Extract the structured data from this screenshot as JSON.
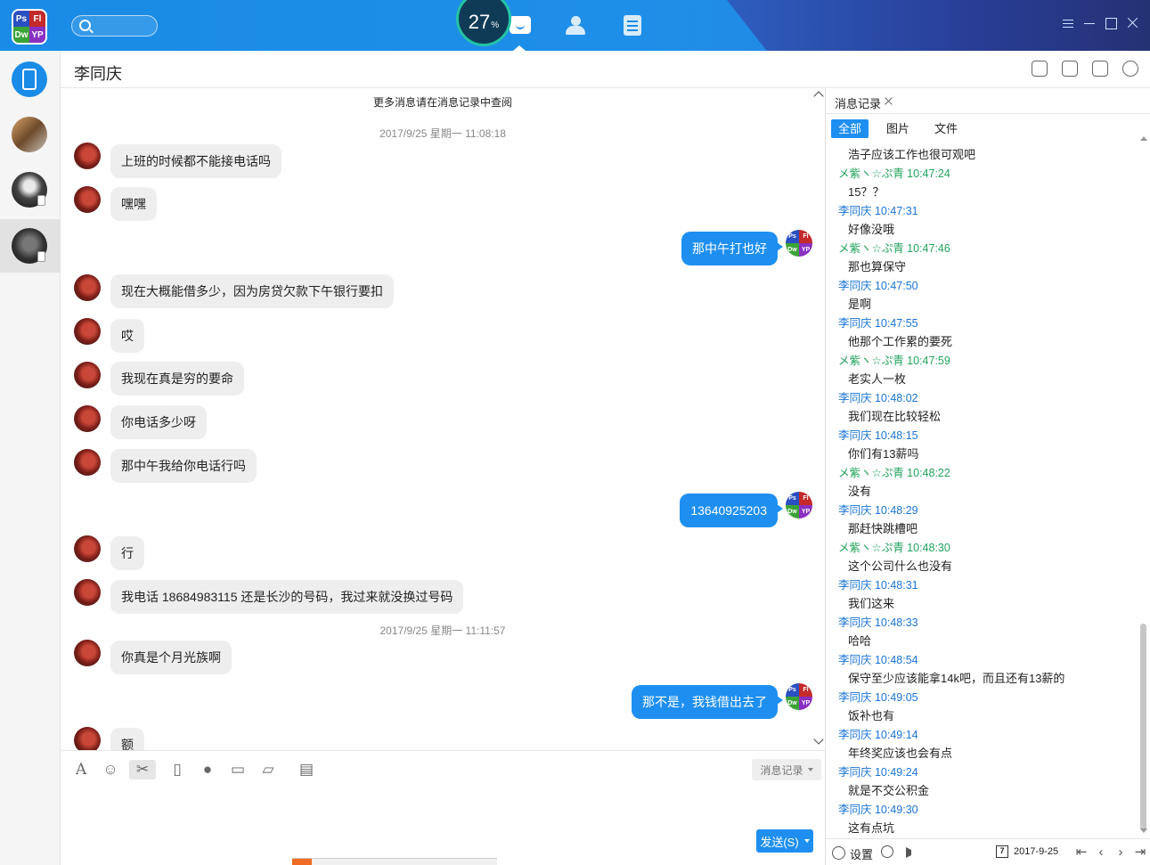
{
  "topbar": {
    "logo_letters": [
      "Ps",
      "Fl",
      "Dw",
      "YP"
    ],
    "logo_colors": [
      "#2a4fc2",
      "#c42a2a",
      "#3aa336",
      "#8a2fc2"
    ],
    "cpu_gauge": "27",
    "cpu_unit": "%"
  },
  "contacts": [
    {
      "name": "device",
      "icon": "phone-icon"
    },
    {
      "name": "contact-1",
      "icon": "avatar"
    },
    {
      "name": "contact-2",
      "icon": "avatar"
    },
    {
      "name": "contact-3",
      "icon": "avatar"
    }
  ],
  "chat": {
    "contact_name": "李同庆",
    "more_hint": "更多消息请在消息记录中查阅",
    "timestamps": [
      "2017/9/25 星期一 11:08:18",
      "2017/9/25 星期一 11:11:57"
    ],
    "messages_in": [
      "上班的时候都不能接电话吗",
      "嘿嘿",
      "现在大概能借多少，因为房贷欠款下午银行要扣",
      "哎",
      "我现在真是穷的要命",
      "你电话多少呀",
      "那中午我给你电话行吗",
      "行",
      "我电话 18684983115  还是长沙的号码，我过来就没换过号码",
      "你真是个月光族啊",
      "额"
    ],
    "messages_out": [
      "那中午打也好",
      "13640925203",
      "那不是，我钱借出去了"
    ]
  },
  "toolbar": {
    "history_label": "消息记录",
    "send_label": "发送(S)"
  },
  "history": {
    "tab_label": "消息记录",
    "filters": [
      "全部",
      "图片",
      "文件"
    ],
    "entries": [
      {
        "type": "text",
        "text": "浩子应该工作也很可观吧"
      },
      {
        "type": "me",
        "text": "メ紫ヽ☆ぷ青 10:47:24"
      },
      {
        "type": "text",
        "text": "15？？"
      },
      {
        "type": "them",
        "text": "李同庆 10:47:31"
      },
      {
        "type": "text",
        "text": "好像没哦"
      },
      {
        "type": "me",
        "text": "メ紫ヽ☆ぷ青 10:47:46"
      },
      {
        "type": "text",
        "text": "那也算保守"
      },
      {
        "type": "them",
        "text": "李同庆 10:47:50"
      },
      {
        "type": "text",
        "text": "是啊"
      },
      {
        "type": "them",
        "text": "李同庆 10:47:55"
      },
      {
        "type": "text",
        "text": "他那个工作累的要死"
      },
      {
        "type": "me",
        "text": "メ紫ヽ☆ぷ青 10:47:59"
      },
      {
        "type": "text",
        "text": "老实人一枚"
      },
      {
        "type": "them",
        "text": "李同庆 10:48:02"
      },
      {
        "type": "text",
        "text": "我们现在比较轻松"
      },
      {
        "type": "them",
        "text": "李同庆 10:48:15"
      },
      {
        "type": "text",
        "text": "你们有13薪吗"
      },
      {
        "type": "me",
        "text": "メ紫ヽ☆ぷ青 10:48:22"
      },
      {
        "type": "text",
        "text": "没有"
      },
      {
        "type": "them",
        "text": "李同庆 10:48:29"
      },
      {
        "type": "text",
        "text": "那赶快跳槽吧"
      },
      {
        "type": "me",
        "text": "メ紫ヽ☆ぷ青 10:48:30"
      },
      {
        "type": "text",
        "text": "这个公司什么也没有"
      },
      {
        "type": "them",
        "text": "李同庆 10:48:31"
      },
      {
        "type": "text",
        "text": "我们这来"
      },
      {
        "type": "them",
        "text": "李同庆 10:48:33"
      },
      {
        "type": "text",
        "text": "哈哈"
      },
      {
        "type": "them",
        "text": "李同庆 10:48:54"
      },
      {
        "type": "text",
        "text": "保守至少应该能拿14k吧，而且还有13薪的"
      },
      {
        "type": "them",
        "text": "李同庆 10:49:05"
      },
      {
        "type": "text",
        "text": "饭补也有"
      },
      {
        "type": "them",
        "text": "李同庆 10:49:14"
      },
      {
        "type": "text",
        "text": "年终奖应该也会有点"
      },
      {
        "type": "them",
        "text": "李同庆 10:49:24"
      },
      {
        "type": "text",
        "text": "就是不交公积金"
      },
      {
        "type": "them",
        "text": "李同庆 10:49:30"
      },
      {
        "type": "text",
        "text": "这有点坑"
      }
    ],
    "settings_label": "设置",
    "calendar_day": "7",
    "date": "2017-9-25"
  },
  "colors": {
    "accent": "#1e8ff1",
    "sender_them": "#1a74d6",
    "sender_me": "#21a35b"
  }
}
